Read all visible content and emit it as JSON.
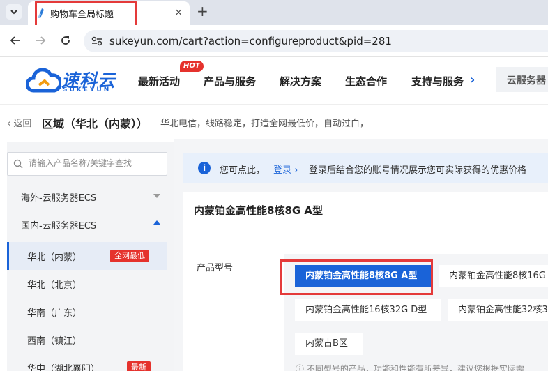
{
  "browser": {
    "tab_title": "购物车全局标题",
    "tab_close": "×",
    "new_tab": "+",
    "url": "sukeyun.com/cart?action=configureproduct&pid=281"
  },
  "header": {
    "logo_text": "速科云",
    "logo_sub": "SUKEYUN",
    "nav": [
      "最新活动",
      "产品与服务",
      "解决方案",
      "生态合作",
      "支持与服务"
    ],
    "hot_badge": "HOT",
    "search_label": "云服务器"
  },
  "page": {
    "back": "返回",
    "title": "区域（华北（内蒙））",
    "description": "华北电信，线路稳定，打造全网最低价，自动过白，"
  },
  "sidebar": {
    "search_placeholder": "请输入产品名称/关键字查找",
    "groups": [
      {
        "label": "海外-云服务器ECS",
        "expanded": false
      },
      {
        "label": "国内-云服务器ECS",
        "expanded": true
      }
    ],
    "items": [
      {
        "label": "华北（内蒙）",
        "badge": "全网最低",
        "active": true
      },
      {
        "label": "华北（北京）"
      },
      {
        "label": "华南（广东）"
      },
      {
        "label": "西南（镇江）"
      },
      {
        "label": "华中（湖北襄阳）",
        "badge": "最新"
      }
    ]
  },
  "notice": {
    "text1": "您可点此，",
    "login": "登录 ›",
    "text2": "登录后结合您的账号情况展示您可实际获得的优惠价格"
  },
  "product": {
    "title": "内蒙铂金高性能8核8G A型",
    "field_label": "产品型号",
    "options": [
      {
        "label": "内蒙铂金高性能8核8G A型",
        "selected": true
      },
      {
        "label": "内蒙铂金高性能8核16G"
      },
      {
        "label": "内蒙铂金高性能16核32G D型"
      },
      {
        "label": "内蒙铂金高性能32核3"
      },
      {
        "label": "内蒙古B区"
      }
    ],
    "note": "不同型号的产品，功能和性能有所差异，建议您根据实际需"
  },
  "colors": {
    "brand": "#1a63d8",
    "badge_red": "#e5322d",
    "highlight_red": "#e43a3a"
  }
}
